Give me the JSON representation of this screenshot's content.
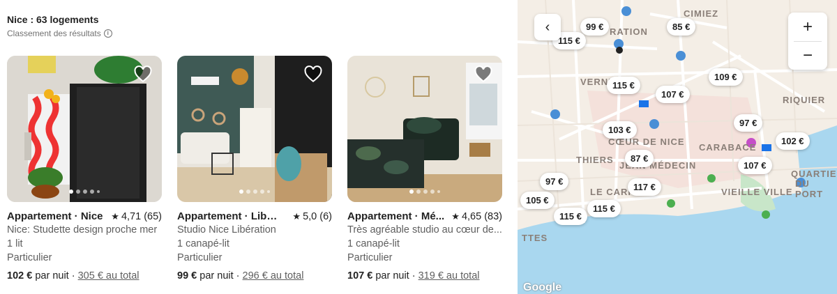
{
  "header": {
    "count_label": "Nice : 63 logements",
    "ranking_label": "Classement des résultats"
  },
  "listings": [
    {
      "type": "Appartement · Nice",
      "rating": "4,71 (65)",
      "title": "Nice: Studette design proche mer",
      "beds": "1 lit",
      "host": "Particulier",
      "price": "102 €",
      "price_unit": "par nuit",
      "separator": "·",
      "total": "305 € au total"
    },
    {
      "type": "Appartement · Libera...",
      "rating": "5,0 (6)",
      "title": "Studio Nice Libération",
      "beds": "1 canapé-lit",
      "host": "Particulier",
      "price": "99 €",
      "price_unit": "par nuit",
      "separator": "·",
      "total": "296 € au total"
    },
    {
      "type": "Appartement · Mé...",
      "rating": "4,65 (83)",
      "title": "Très agréable studio au cœur de...",
      "beds": "1 canapé-lit",
      "host": "Particulier",
      "price": "107 €",
      "price_unit": "par nuit",
      "separator": "·",
      "total": "319 € au total"
    }
  ],
  "map": {
    "back_icon": "chevron-left-icon",
    "zoom_in": "+",
    "zoom_out": "−",
    "labels": {
      "cimiez": "CIMIEZ",
      "liberation": "RATION",
      "riquier": "RIQUIER",
      "vernier": "VERNIE",
      "thiers": "THIERS",
      "coeur": "CŒUR DE NICE",
      "jean_medecin": "JEAN MÉDECIN",
      "carabacel": "CARABACE",
      "quartier": "QUARTIER",
      "du_port": "DU PORT",
      "carre": "LE CARRÉ",
      "vieille_ville": "VIEILLE VILLE",
      "ttes": "TTES",
      "google": "Google"
    },
    "pins": [
      "99 €",
      "85 €",
      "115 €",
      "115 €",
      "107 €",
      "109 €",
      "103 €",
      "97 €",
      "102 €",
      "87 €",
      "107 €",
      "97 €",
      "117 €",
      "105 €",
      "115 €",
      "115 €"
    ]
  },
  "colors": {
    "water": "#a9d7ef",
    "land": "#f4eee6",
    "road": "#ffffff",
    "park": "#c8e6c9",
    "pink_area": "#f3dcd6"
  }
}
